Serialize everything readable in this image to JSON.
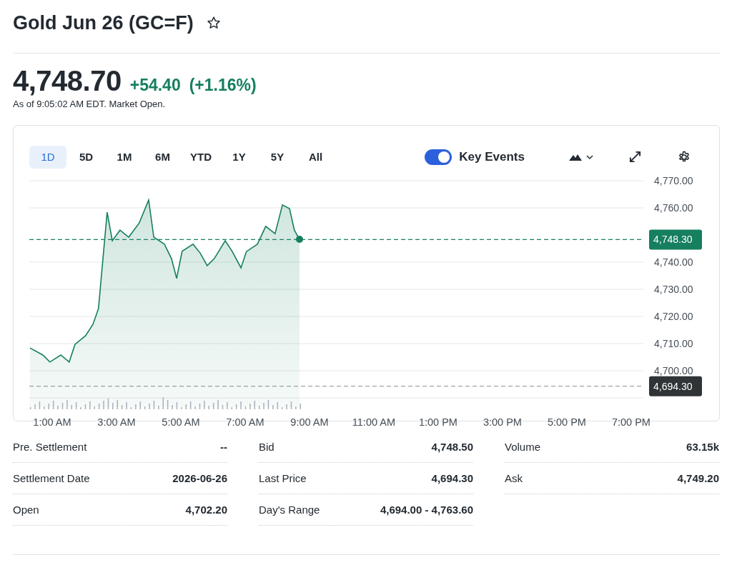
{
  "quote": {
    "title": "Gold Jun 26 (GC=F)",
    "price": "4,748.70",
    "change": "+54.40",
    "change_percent": "(+1.16%)",
    "as_of": "As of 9:05:02 AM EDT. Market Open."
  },
  "chart": {
    "ranges": [
      {
        "label": "1D",
        "selected": true
      },
      {
        "label": "5D",
        "selected": false
      },
      {
        "label": "1M",
        "selected": false
      },
      {
        "label": "6M",
        "selected": false
      },
      {
        "label": "YTD",
        "selected": false
      },
      {
        "label": "1Y",
        "selected": false
      },
      {
        "label": "5Y",
        "selected": false
      },
      {
        "label": "All",
        "selected": false
      }
    ],
    "key_events": {
      "label": "Key Events",
      "on": true
    },
    "chart_data": {
      "type": "area",
      "x": [
        0.31,
        0.71,
        0.93,
        1.27,
        1.53,
        1.71,
        2.04,
        2.27,
        2.44,
        2.56,
        2.71,
        2.87,
        3.11,
        3.38,
        3.71,
        4.0,
        4.16,
        4.49,
        4.71,
        4.87,
        5.04,
        5.38,
        5.6,
        5.82,
        6.04,
        6.38,
        6.6,
        6.87,
        7.04,
        7.38,
        7.64,
        7.93,
        8.16,
        8.38,
        8.53,
        8.69
      ],
      "series": [
        {
          "color": "#157f5f",
          "values": [
            4708.4,
            4705.8,
            4703.2,
            4705.8,
            4703.2,
            4709.7,
            4712.9,
            4717.1,
            4722.9,
            4738.7,
            4758.4,
            4747.9,
            4751.8,
            4749.2,
            4754.5,
            4762.9,
            4749.2,
            4746.6,
            4741.3,
            4734.0,
            4744.0,
            4746.6,
            4743.4,
            4738.7,
            4741.3,
            4747.9,
            4743.9,
            4737.9,
            4743.9,
            4746.6,
            4753.2,
            4750.5,
            4761.1,
            4759.7,
            4751.8,
            4748.4
          ]
        }
      ],
      "xlim": [
        0.29,
        19.38
      ],
      "ylim": [
        4690,
        4770
      ],
      "grid": true,
      "xticks": [
        {
          "value": 1,
          "label": "1:00 AM"
        },
        {
          "value": 3,
          "label": "3:00 AM"
        },
        {
          "value": 5,
          "label": "5:00 AM"
        },
        {
          "value": 7,
          "label": "7:00 AM"
        },
        {
          "value": 9,
          "label": "9:00 AM"
        },
        {
          "value": 11,
          "label": "11:00 AM"
        },
        {
          "value": 13,
          "label": "1:00 PM"
        },
        {
          "value": 15,
          "label": "3:00 PM"
        },
        {
          "value": 17,
          "label": "5:00 PM"
        },
        {
          "value": 19,
          "label": "7:00 PM"
        }
      ],
      "yticks": [
        {
          "value": 4770,
          "label": "4,770.00"
        },
        {
          "value": 4760,
          "label": "4,760.00"
        },
        {
          "value": 4740,
          "label": "4,740.00"
        },
        {
          "value": 4730,
          "label": "4,730.00"
        },
        {
          "value": 4720,
          "label": "4,720.00"
        },
        {
          "value": 4710,
          "label": "4,710.00"
        },
        {
          "value": 4700,
          "label": "4,700.00"
        }
      ],
      "ref_lines": [
        {
          "axis": "y",
          "value": 4748.3,
          "label": "4,748.30",
          "color": "#157f5f"
        },
        {
          "axis": "y",
          "value": 4694.3,
          "label": "4,694.30",
          "color": "#2f3437"
        }
      ]
    }
  },
  "stats": [
    [
      {
        "label": "Pre. Settlement",
        "value": "--"
      },
      {
        "label": "Settlement Date",
        "value": "2026-06-26"
      },
      {
        "label": "Open",
        "value": "4,702.20"
      }
    ],
    [
      {
        "label": "Bid",
        "value": "4,748.50"
      },
      {
        "label": "Last Price",
        "value": "4,694.30"
      },
      {
        "label": "Day's Range",
        "value": "4,694.00 - 4,763.60"
      }
    ],
    [
      {
        "label": "Volume",
        "value": "63.15k"
      },
      {
        "label": "Ask",
        "value": "4,749.20"
      }
    ]
  ]
}
